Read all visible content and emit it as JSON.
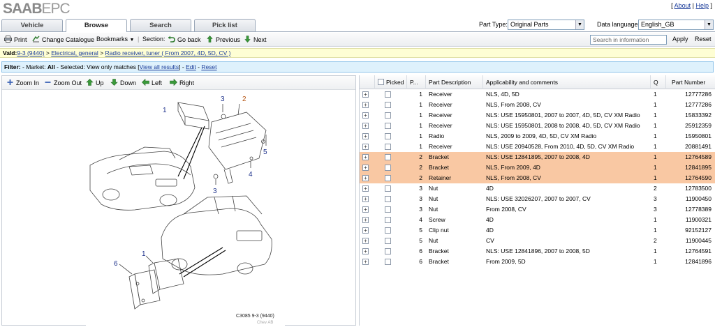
{
  "app": {
    "logo_brand": "SAAB",
    "logo_suffix": "EPC"
  },
  "toplinks": {
    "about": "About",
    "help": "Help"
  },
  "tabs": [
    {
      "label": "Vehicle",
      "active": false
    },
    {
      "label": "Browse",
      "active": true
    },
    {
      "label": "Search",
      "active": false
    },
    {
      "label": "Pick list",
      "active": false
    }
  ],
  "part_type": {
    "label": "Part Type:",
    "value": "Original Parts"
  },
  "data_language": {
    "label": "Data language:",
    "value": "English_GB"
  },
  "toolbar": {
    "print": "Print",
    "change_catalogue": "Change Catalogue",
    "bookmarks": "Bookmarks",
    "section": "Section:",
    "go_back": "Go back",
    "previous": "Previous",
    "next": "Next",
    "search_placeholder": "Search in information",
    "apply": "Apply",
    "reset": "Reset"
  },
  "valid": {
    "label": "Vald:",
    "model": "9-3 (9440)",
    "category": "Electrical, general",
    "section": "Radio receiver, tuner ( From 2007, 4D, 5D, CV )",
    "sep": ">"
  },
  "filter": {
    "label": "Filter:",
    "market_label": "- Market:",
    "market_value": "All",
    "selected_label": "- Selected:",
    "selected_value": "View only matches",
    "view_all": "View all results",
    "edit": "Edit",
    "reset": "Reset"
  },
  "illustration_toolbar": {
    "zoom_in": "Zoom In",
    "zoom_out": "Zoom Out",
    "up": "Up",
    "down": "Down",
    "left": "Left",
    "right": "Right"
  },
  "illustration": {
    "caption": "C3085 9-3 (9440)",
    "watermark": "Chev AB",
    "callouts": [
      "1",
      "2",
      "3",
      "3",
      "4",
      "5",
      "1",
      "6"
    ]
  },
  "colors": {
    "highlight_row": "#f9c8a3",
    "link": "#1a3c9a",
    "valid_bg": "#fefed4",
    "filter_bg": "#def1fc"
  },
  "table": {
    "headers": {
      "picked": "Picked",
      "pos": "P...",
      "description": "Part Description",
      "applicability": "Applicability and comments",
      "qty": "Q",
      "part_number": "Part Number"
    },
    "rows": [
      {
        "pos": "1",
        "desc": "Receiver",
        "appl": "NLS, 4D, 5D",
        "qty": "1",
        "pn": "12777286",
        "hl": false
      },
      {
        "pos": "1",
        "desc": "Receiver",
        "appl": "NLS, From 2008, CV",
        "qty": "1",
        "pn": "12777286",
        "hl": false
      },
      {
        "pos": "1",
        "desc": "Receiver",
        "appl": "NLS: USE 15950801, 2007 to 2007, 4D, 5D, CV XM Radio",
        "qty": "1",
        "pn": "15833392",
        "hl": false
      },
      {
        "pos": "1",
        "desc": "Receiver",
        "appl": "NLS: USE 15950801, 2008 to 2008, 4D, 5D, CV XM Radio",
        "qty": "1",
        "pn": "25912359",
        "hl": false
      },
      {
        "pos": "1",
        "desc": "Radio",
        "appl": "NLS, 2009 to 2009, 4D, 5D, CV XM Radio",
        "qty": "1",
        "pn": "15950801",
        "hl": false
      },
      {
        "pos": "1",
        "desc": "Receiver",
        "appl": "NLS: USE 20940528, From 2010, 4D, 5D, CV XM Radio",
        "qty": "1",
        "pn": "20881491",
        "hl": false
      },
      {
        "pos": "2",
        "desc": "Bracket",
        "appl": "NLS: USE 12841895, 2007 to 2008, 4D",
        "qty": "1",
        "pn": "12764589",
        "hl": true
      },
      {
        "pos": "2",
        "desc": "Bracket",
        "appl": "NLS, From 2009, 4D",
        "qty": "1",
        "pn": "12841895",
        "hl": true
      },
      {
        "pos": "2",
        "desc": "Retainer",
        "appl": "NLS, From 2008, CV",
        "qty": "1",
        "pn": "12764590",
        "hl": true
      },
      {
        "pos": "3",
        "desc": "Nut",
        "appl": "4D",
        "qty": "2",
        "pn": "12783500",
        "hl": false
      },
      {
        "pos": "3",
        "desc": "Nut",
        "appl": "NLS: USE 32026207, 2007 to 2007, CV",
        "qty": "3",
        "pn": "11900450",
        "hl": false
      },
      {
        "pos": "3",
        "desc": "Nut",
        "appl": "From 2008, CV",
        "qty": "3",
        "pn": "12778389",
        "hl": false
      },
      {
        "pos": "4",
        "desc": "Screw",
        "appl": "4D",
        "qty": "1",
        "pn": "11900321",
        "hl": false
      },
      {
        "pos": "5",
        "desc": "Clip nut",
        "appl": "4D",
        "qty": "1",
        "pn": "92152127",
        "hl": false
      },
      {
        "pos": "5",
        "desc": "Nut",
        "appl": "CV",
        "qty": "2",
        "pn": "11900445",
        "hl": false
      },
      {
        "pos": "6",
        "desc": "Bracket",
        "appl": "NLS: USE 12841896, 2007 to 2008, 5D",
        "qty": "1",
        "pn": "12764591",
        "hl": false
      },
      {
        "pos": "6",
        "desc": "Bracket",
        "appl": "From 2009, 5D",
        "qty": "1",
        "pn": "12841896",
        "hl": false
      }
    ]
  }
}
